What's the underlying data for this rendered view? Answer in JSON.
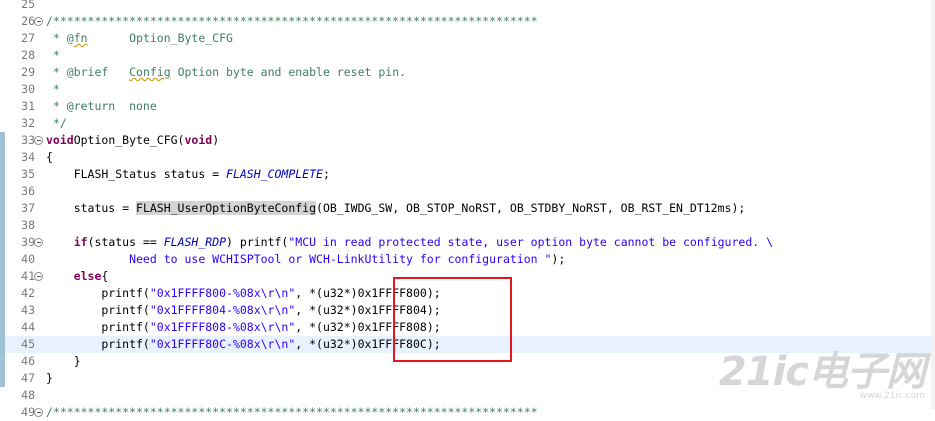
{
  "lines": [
    {
      "n": "25",
      "fold": false,
      "bar": false,
      "hl": false,
      "t": []
    },
    {
      "n": "26",
      "fold": true,
      "bar": false,
      "hl": false,
      "t": [
        [
          "tc",
          "/**********************************************************************"
        ]
      ]
    },
    {
      "n": "27",
      "fold": false,
      "bar": false,
      "hl": false,
      "t": [
        [
          "tc",
          " * @"
        ],
        [
          "tc sq",
          "fn"
        ],
        [
          "tc",
          "      Option_Byte_CFG"
        ]
      ]
    },
    {
      "n": "28",
      "fold": false,
      "bar": false,
      "hl": false,
      "t": [
        [
          "tc",
          " *"
        ]
      ]
    },
    {
      "n": "29",
      "fold": false,
      "bar": false,
      "hl": false,
      "t": [
        [
          "tc",
          " * @brief   "
        ],
        [
          "tc sq",
          "Config"
        ],
        [
          "tc",
          " Option byte and enable reset pin."
        ]
      ]
    },
    {
      "n": "30",
      "fold": false,
      "bar": false,
      "hl": false,
      "t": [
        [
          "tc",
          " *"
        ]
      ]
    },
    {
      "n": "31",
      "fold": false,
      "bar": false,
      "hl": false,
      "t": [
        [
          "tc",
          " * @return  none"
        ]
      ]
    },
    {
      "n": "32",
      "fold": false,
      "bar": false,
      "hl": false,
      "t": [
        [
          "tc",
          " */"
        ]
      ]
    },
    {
      "n": "33",
      "fold": true,
      "bar": true,
      "hl": false,
      "t": [
        [
          "tk",
          "void"
        ],
        [
          "",
          "Option_Byte_CFG("
        ],
        [
          "tk",
          "void"
        ],
        [
          "",
          ")"
        ]
      ]
    },
    {
      "n": "34",
      "fold": false,
      "bar": true,
      "hl": false,
      "t": [
        [
          "",
          "{"
        ]
      ]
    },
    {
      "n": "35",
      "fold": false,
      "bar": true,
      "hl": false,
      "t": [
        [
          "",
          "    FLASH_Status status = "
        ],
        [
          "it",
          "FLASH_COMPLETE"
        ],
        [
          "",
          ";"
        ]
      ]
    },
    {
      "n": "36",
      "fold": false,
      "bar": true,
      "hl": false,
      "t": []
    },
    {
      "n": "37",
      "fold": false,
      "bar": true,
      "hl": false,
      "t": [
        [
          "",
          "    status = "
        ],
        [
          "sel",
          "FLASH_UserOptionByteConfig"
        ],
        [
          "",
          "(OB_IWDG_SW, OB_STOP_NoRST, OB_STDBY_NoRST, OB_RST_EN_DT12ms);"
        ]
      ]
    },
    {
      "n": "38",
      "fold": false,
      "bar": true,
      "hl": false,
      "t": []
    },
    {
      "n": "39",
      "fold": true,
      "bar": true,
      "hl": false,
      "t": [
        [
          "",
          "    "
        ],
        [
          "tk",
          "if"
        ],
        [
          "",
          "(status == "
        ],
        [
          "it",
          "FLASH_RDP"
        ],
        [
          "",
          ") printf("
        ],
        [
          "str",
          "\"MCU in read protected state, user option byte cannot be configured. \\"
        ]
      ]
    },
    {
      "n": "40",
      "fold": false,
      "bar": true,
      "hl": false,
      "t": [
        [
          "str",
          "            Need to use WCHISPTool or WCH-LinkUtility for configuration \""
        ],
        [
          "",
          ");"
        ]
      ]
    },
    {
      "n": "41",
      "fold": true,
      "bar": true,
      "hl": false,
      "t": [
        [
          "",
          "    "
        ],
        [
          "tk",
          "else"
        ],
        [
          "",
          "{"
        ]
      ]
    },
    {
      "n": "42",
      "fold": false,
      "bar": true,
      "hl": false,
      "t": [
        [
          "",
          "        printf("
        ],
        [
          "str",
          "\"0x1FFFF800-%08x\\r\\n\""
        ],
        [
          "",
          ", *(u32*)0x1FFFF800);"
        ]
      ]
    },
    {
      "n": "43",
      "fold": false,
      "bar": true,
      "hl": false,
      "t": [
        [
          "",
          "        printf("
        ],
        [
          "str",
          "\"0x1FFFF804-%08x\\r\\n\""
        ],
        [
          "",
          ", *(u32*)0x1FFFF804);"
        ]
      ]
    },
    {
      "n": "44",
      "fold": false,
      "bar": true,
      "hl": false,
      "t": [
        [
          "",
          "        printf("
        ],
        [
          "str",
          "\"0x1FFFF808-%08x\\r\\n\""
        ],
        [
          "",
          ", *(u32*)0x1FFFF808);"
        ]
      ]
    },
    {
      "n": "45",
      "fold": false,
      "bar": true,
      "hl": true,
      "t": [
        [
          "",
          "        printf("
        ],
        [
          "str",
          "\"0x1FFFF80C-%08x\\r\\n\""
        ],
        [
          "",
          ", *(u32*)0x1FFFF80C);"
        ]
      ]
    },
    {
      "n": "46",
      "fold": false,
      "bar": true,
      "hl": false,
      "t": [
        [
          "",
          "    }"
        ]
      ]
    },
    {
      "n": "47",
      "fold": false,
      "bar": true,
      "hl": false,
      "t": [
        [
          "",
          "}"
        ]
      ]
    },
    {
      "n": "48",
      "fold": false,
      "bar": false,
      "hl": false,
      "t": []
    },
    {
      "n": "49",
      "fold": true,
      "bar": false,
      "hl": false,
      "t": [
        [
          "tc",
          "/**********************************************************************"
        ]
      ]
    }
  ],
  "watermark": {
    "main": "21ic电子网",
    "sub": "www.21ic.com"
  },
  "colors": {
    "comment": "#3f7f5f",
    "keyword": "#7f0055",
    "string": "#2a00ff",
    "constant": "#0000c0",
    "highlight": "#e8f2fe",
    "redbox": "#e8141e"
  }
}
